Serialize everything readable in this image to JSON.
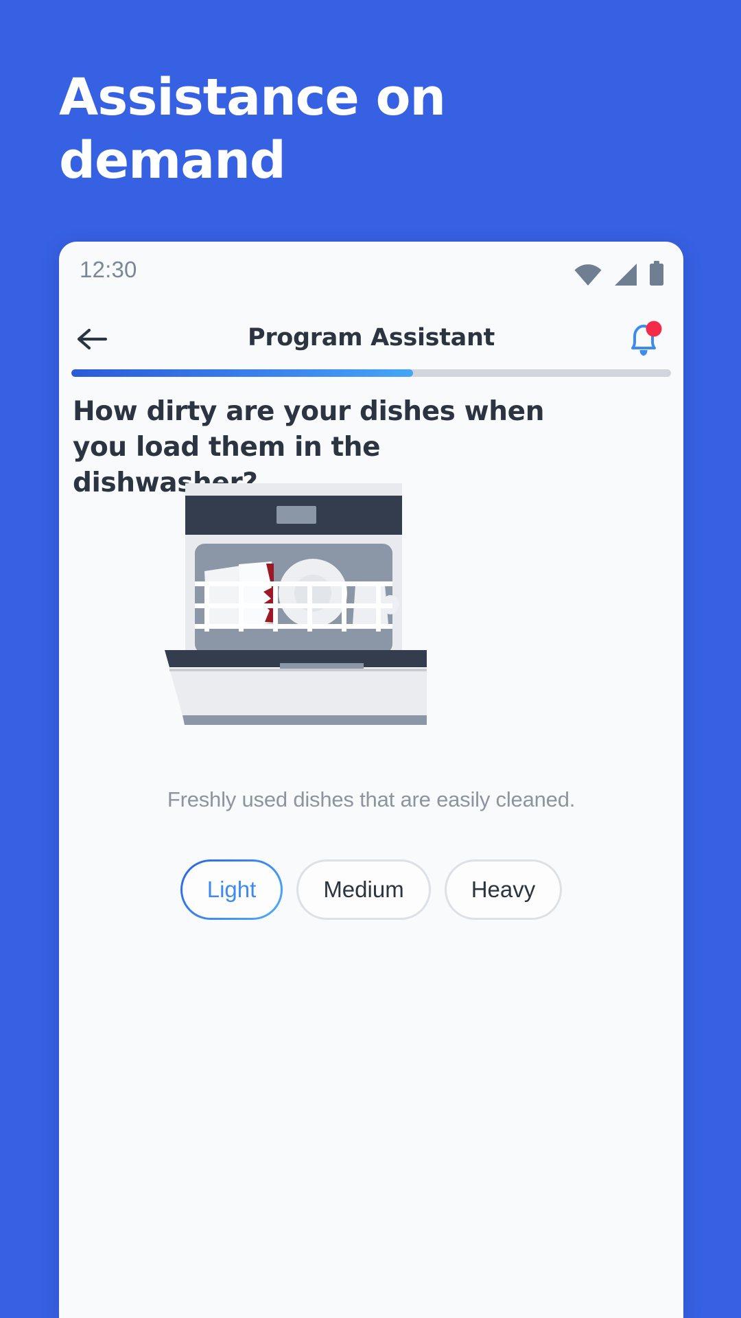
{
  "theme": {
    "background_blue": "#3761E3",
    "card_background": "#F9FAFC",
    "accent_blue": "#3E8BF0",
    "text_dark": "#2C3442",
    "text_muted": "#8D949E",
    "badge_red": "#F42B48"
  },
  "hero": {
    "title": "Assistance on\ndemand"
  },
  "phone": {
    "status_bar": {
      "time": "12:30",
      "icons": [
        "wifi-icon",
        "signal-icon",
        "battery-icon"
      ]
    },
    "app_bar": {
      "back_icon": "arrow-left-icon",
      "title": "Program Assistant",
      "notification_icon": "bell-icon",
      "has_badge": true
    },
    "progress": {
      "percent": 57
    },
    "question": "How dirty are your dishes when you load them in the dishwasher?",
    "illustration": "dishwasher-open-with-dishes",
    "caption": "Freshly used dishes that are easily cleaned.",
    "options": [
      {
        "label": "Light",
        "selected": true
      },
      {
        "label": "Medium",
        "selected": false
      },
      {
        "label": "Heavy",
        "selected": false
      }
    ]
  }
}
